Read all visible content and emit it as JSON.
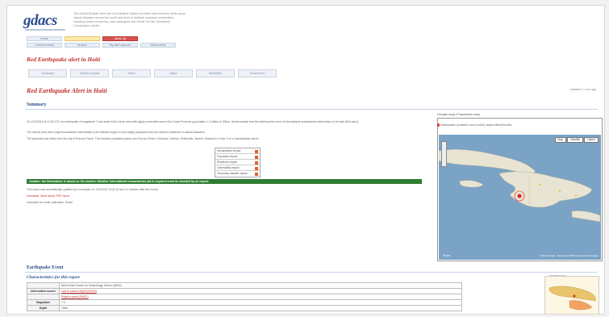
{
  "header": {
    "logo": "gdacs",
    "intro": "The Global Disaster Alert and Coordination System provides near real-time alerts about natural disasters around the world and tools to facilitate response coordination, including media monitoring, map catalogues and Virtual On-Site Operations Coordination Centre."
  },
  "nav": {
    "row1": [
      "Home",
      "",
      "Alerts (3)"
    ],
    "row2": [
      "Current events",
      "Archive",
      "My alert account",
      "About alerts"
    ]
  },
  "alert_title": "Red Earthquake alert in Haiti",
  "sub_tabs": [
    "Summary",
    "Detailed impact",
    "News",
    "Maps",
    "ReliefWeb",
    "Documents"
  ],
  "report": {
    "title": "Red Earthquake Alert in Haiti",
    "updated": "Updated: 1 hour ago",
    "summary_heading": "Summary",
    "paragraphs": [
      "On 1/12/2010 at 21:53 UTC an earthquake of magnitude 7 and depth 10km hit an area with highly vulnerable area in the Ouest Province (population 1.3 million in 20km). Alerts indicate that the likelihood for need of international humanitarian intervention to be high (Red alert).",
      "The nearby area has a high humanitarian vulnerability in the affected region is very highly populated and has medium resilience to natural disasters.",
      "The epicentre was 16km from the city of Port-au-Prince. The heaviest populated places are Port-au-Prince, Carrefour, Delmas, Petionville, Jacmel. Nearest is 1 hour 2 on a humanitarian report."
    ],
    "impact_rows": [
      "Humanitarian impact",
      "Population impact",
      "Resilience impact",
      "Vulnerability impact",
      "Secondary disaster impact"
    ],
    "green_notice": "Caution: the information is based on the models. Whether international humanitarian aid is required must be decided by an expert.",
    "notes": [
      "This report was automatically updated by a computer on 1/12/2010 23:42 (0 hour 51 minutes after the event).",
      "Download: Word report, PDF report",
      "Subscribe for email notification: Email"
    ]
  },
  "map": {
    "links": "Google map | Population map",
    "legend": "Earthquakes (small/ten most recent)   Largest affected cities",
    "buttons": [
      "Map",
      "Satellite",
      "Hybrid"
    ],
    "scale": "50 km",
    "copyright": "©2010 Google - Map data ©2010 Europa Technologies"
  },
  "earthquake": {
    "heading": "Earthquake Event",
    "characteristics_heading": "Characteristics for this report",
    "rows": [
      {
        "key": "",
        "value": "World Data Center for Seismology, Denver (NEIC)"
      },
      {
        "key": "Information source",
        "value": "Link to source report (USGS)"
      },
      {
        "key": "",
        "value": "Region report (EMSC)"
      },
      {
        "key": "Magnitude",
        "value": "7.0"
      },
      {
        "key": "Depth",
        "value": "10km"
      }
    ],
    "thumb_label": "Overview map"
  }
}
